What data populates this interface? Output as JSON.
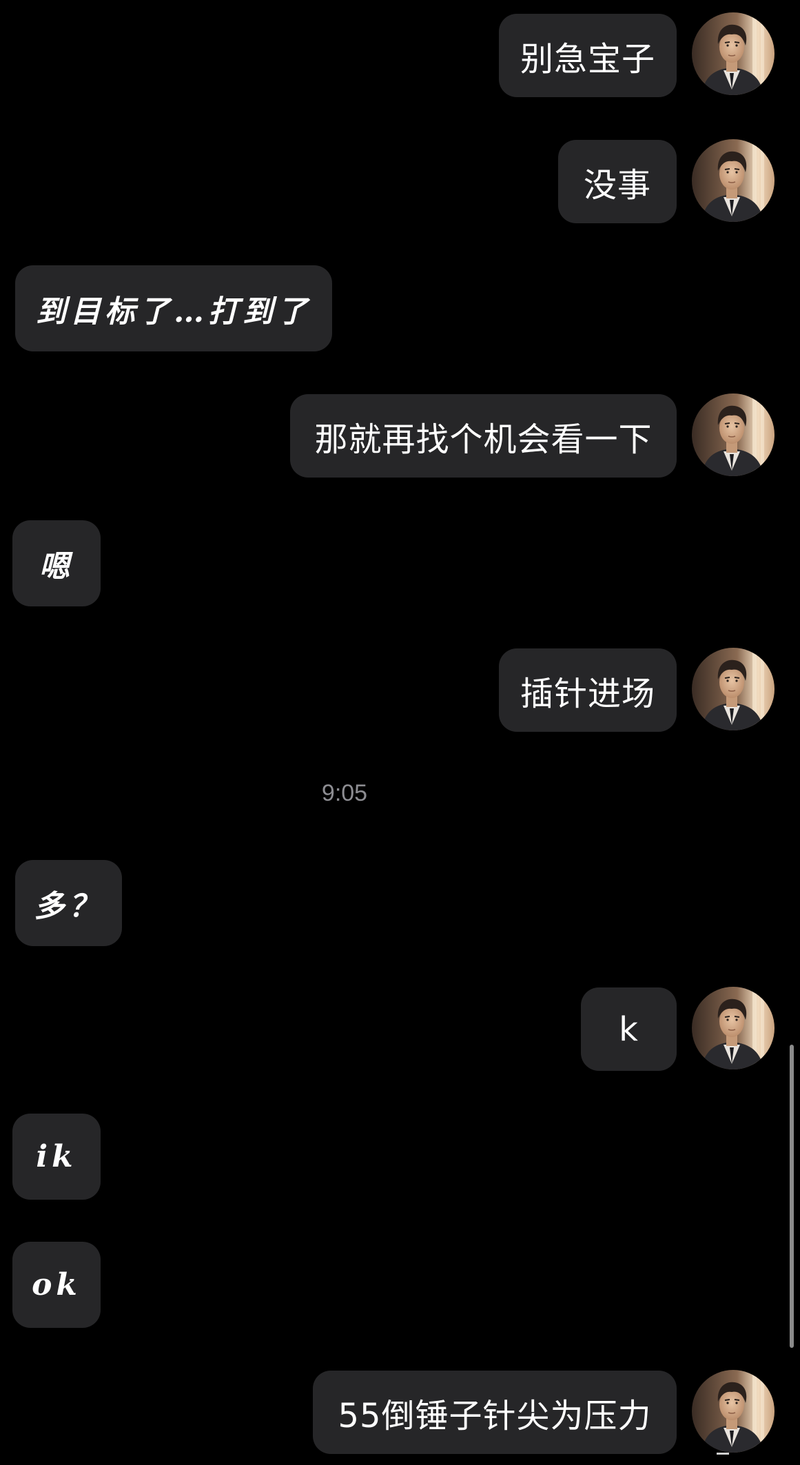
{
  "contact": {
    "avatar_icon": "user-portrait-avatar"
  },
  "messages": [
    {
      "id": 1,
      "side": "outgoing",
      "text": "别急宝子"
    },
    {
      "id": 2,
      "side": "outgoing",
      "text": "没事"
    },
    {
      "id": 3,
      "side": "incoming",
      "text": "到目标了…打到了"
    },
    {
      "id": 4,
      "side": "outgoing",
      "text": "那就再找个机会看一下"
    },
    {
      "id": 5,
      "side": "incoming",
      "text": "嗯"
    },
    {
      "id": 6,
      "side": "outgoing",
      "text": "插针进场"
    },
    {
      "id": 7,
      "side": "incoming",
      "text": "多？"
    },
    {
      "id": 8,
      "side": "outgoing",
      "text": "k"
    },
    {
      "id": 9,
      "side": "incoming",
      "text": "ik"
    },
    {
      "id": 10,
      "side": "incoming",
      "text": "ok"
    },
    {
      "id": 11,
      "side": "outgoing",
      "text": "55倒锤子针尖为压力"
    }
  ],
  "timestamp": "9:05",
  "colors": {
    "background": "#000000",
    "bubble": "#262628",
    "text": "#ffffff",
    "timestamp": "#8d8d92"
  }
}
